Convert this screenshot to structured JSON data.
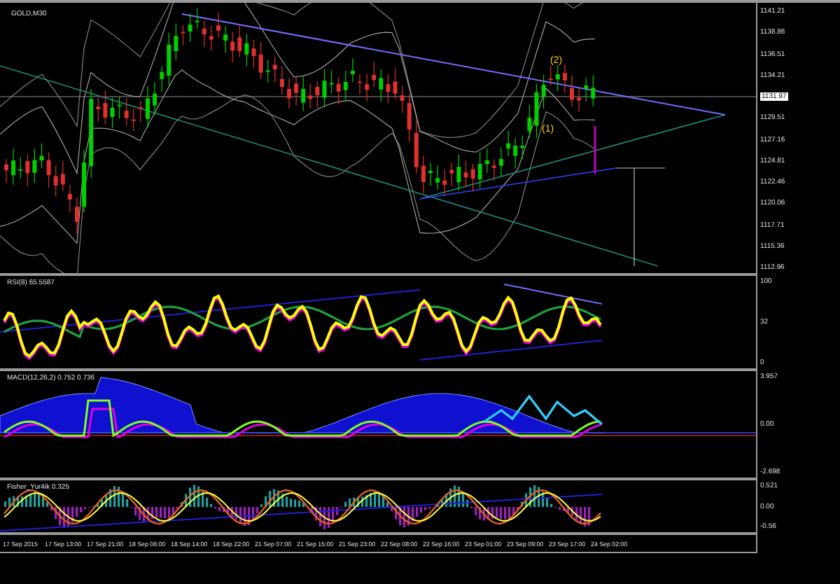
{
  "main_panel": {
    "title": "GOLD,M30",
    "annotations": [
      "(2)",
      "(1)"
    ],
    "price_ticks": [
      {
        "label": "1141.21",
        "kind": "tick"
      },
      {
        "label": "1138.86",
        "kind": "tick"
      },
      {
        "label": "1136.51",
        "kind": "tick"
      },
      {
        "label": "1134.21",
        "kind": "tick"
      },
      {
        "label": "1131.97",
        "kind": "current"
      },
      {
        "label": "1129.51",
        "kind": "tick"
      },
      {
        "label": "1127.16",
        "kind": "tick"
      },
      {
        "label": "1124.81",
        "kind": "tick"
      },
      {
        "label": "1122.46",
        "kind": "tick"
      },
      {
        "label": "1120.06",
        "kind": "tick"
      },
      {
        "label": "1117.71",
        "kind": "tick"
      },
      {
        "label": "1115.36",
        "kind": "tick"
      },
      {
        "label": "1112.96",
        "kind": "tick"
      }
    ]
  },
  "rsi_panel": {
    "title": "RSI(8) 65.5587",
    "ticks": [
      "100",
      "32",
      "0"
    ]
  },
  "macd_panel": {
    "title": "MACD(12,26,2) 0.752 0.736",
    "ticks": [
      "3.957",
      "0.00",
      "-2.698"
    ]
  },
  "fisher_panel": {
    "title": "Fisher_Yur4ik 0.325",
    "ticks": [
      "0.521",
      "0.00",
      "-0.56"
    ]
  },
  "time_axis": [
    "17 Sep 2015",
    "17 Sep 13:00",
    "17 Sep 21:00",
    "18 Sep 06:00",
    "18 Sep 14:00",
    "18 Sep 22:00",
    "21 Sep 07:00",
    "21 Sep 15:00",
    "21 Sep 23:00",
    "22 Sep 08:00",
    "22 Sep 16:00",
    "23 Sep 01:00",
    "23 Sep 09:00",
    "23 Sep 17:00",
    "24 Sep 02:00"
  ]
}
